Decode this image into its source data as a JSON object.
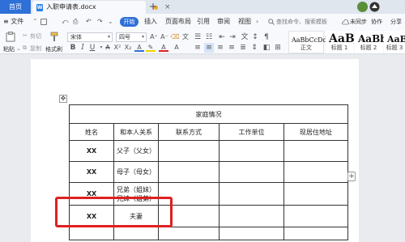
{
  "tabs": {
    "home": "首页",
    "document_title": "入职申请表.docx",
    "close": "×",
    "add": "+"
  },
  "menu": {
    "file": "≡ 文件",
    "icons": [
      "⌃",
      "⧉",
      "⎙",
      "⤺",
      "↶",
      "↷",
      "⌄"
    ],
    "start": "开始",
    "insert": "插入",
    "layout": "页面布局",
    "references": "引用",
    "review": "审阅",
    "view": "视图",
    "more": "›",
    "search": "查找命令、搜索模板",
    "sync": "未同步",
    "collab": "协作",
    "share": "分享"
  },
  "ribbon": {
    "paste": "粘贴",
    "cut": "剪切",
    "copy": "复制",
    "format_painter": "格式刷",
    "font": "宋体",
    "size": "四号",
    "bold": "B",
    "italic": "I",
    "underline": "U",
    "style_normal": {
      "sample": "AaBbCcDd",
      "label": "正文"
    },
    "style_h1": {
      "sample": "AaB",
      "label": "标题 1"
    },
    "style_h2": {
      "sample": "AaBb",
      "label": "标题 2"
    },
    "style_h3": {
      "sample": "AaBb(",
      "label": "标题 3"
    }
  },
  "table": {
    "title": "家庭情况",
    "headers": [
      "姓名",
      "和本人关系",
      "联系方式",
      "工作单位",
      "现居住地址"
    ],
    "rows": [
      {
        "name": "XX",
        "relation": "父子（父女）"
      },
      {
        "name": "XX",
        "relation": "母子（母女）"
      },
      {
        "name": "XX",
        "relation_line1": "兄弟（姐妹）",
        "relation_line2": "兄妹（姐弟）"
      },
      {
        "name": "XX",
        "relation": "夫妻"
      },
      {
        "name": "",
        "relation": ""
      }
    ]
  },
  "colors": {
    "accent": "#2f6fd8",
    "highlight": "#e02020"
  }
}
